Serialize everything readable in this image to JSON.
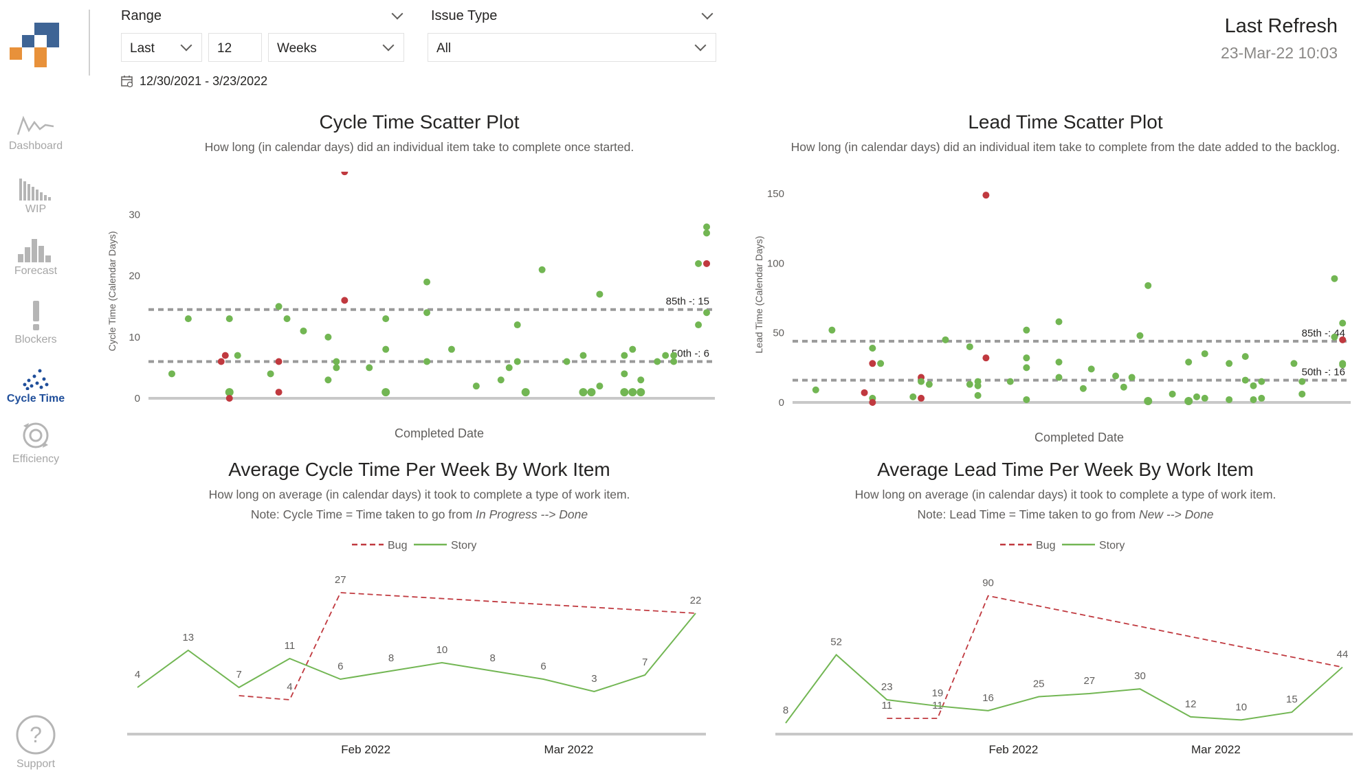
{
  "sidebar": {
    "items": [
      {
        "label": "Dashboard",
        "icon": "line-chart-icon",
        "active": false
      },
      {
        "label": "WIP",
        "icon": "bar-histogram-icon",
        "active": false
      },
      {
        "label": "Forecast",
        "icon": "bar-chart-icon",
        "active": false
      },
      {
        "label": "Blockers",
        "icon": "exclamation-icon",
        "active": false
      },
      {
        "label": "Cycle Time",
        "icon": "scatter-icon",
        "active": true
      },
      {
        "label": "Efficiency",
        "icon": "gear-cycle-icon",
        "active": false
      }
    ],
    "support_label": "Support",
    "support_icon": "question-icon"
  },
  "filters": {
    "range_label": "Range",
    "range_mode": "Last",
    "range_count": "12",
    "range_unit": "Weeks",
    "issue_type_label": "Issue Type",
    "issue_type_value": "All",
    "date_range": "12/30/2021 - 3/23/2022"
  },
  "refresh": {
    "title": "Last Refresh",
    "value": "23-Mar-22 10:03"
  },
  "colors": {
    "story": "#72b653",
    "bug": "#c0393f",
    "percentile_line": "#9a9a9a",
    "active_nav": "#1f4e9a"
  },
  "cycle_scatter": {
    "title": "Cycle Time Scatter Plot",
    "subtitle": "How long (in calendar days) did an individual item take to complete once started.",
    "chart_data": {
      "type": "scatter",
      "xlabel": "Completed Date",
      "ylabel": "Cycle Time (Calendar Days)",
      "ylim": [
        0,
        35
      ],
      "yticks": [
        "0",
        "10",
        "20",
        "30"
      ],
      "percentiles": [
        {
          "label": "85th -: 15",
          "value": 14.5
        },
        {
          "label": "50th -: 6",
          "value": 6
        }
      ],
      "points": [
        {
          "x": 1,
          "y": 4,
          "type": "Story"
        },
        {
          "x": 3,
          "y": 13,
          "type": "Story"
        },
        {
          "x": 7,
          "y": 6,
          "type": "Bug"
        },
        {
          "x": 7.5,
          "y": 7,
          "type": "Bug"
        },
        {
          "x": 8,
          "y": 13,
          "type": "Story"
        },
        {
          "x": 8,
          "y": 1,
          "type": "Story"
        },
        {
          "x": 8,
          "y": 0,
          "type": "Bug"
        },
        {
          "x": 9,
          "y": 7,
          "type": "Story"
        },
        {
          "x": 13,
          "y": 4,
          "type": "Story"
        },
        {
          "x": 14,
          "y": 15,
          "type": "Story"
        },
        {
          "x": 14,
          "y": 6,
          "type": "Bug"
        },
        {
          "x": 14,
          "y": 1,
          "type": "Bug"
        },
        {
          "x": 15,
          "y": 13,
          "type": "Story"
        },
        {
          "x": 17,
          "y": 11,
          "type": "Story"
        },
        {
          "x": 20,
          "y": 10,
          "type": "Story"
        },
        {
          "x": 20,
          "y": 3,
          "type": "Story"
        },
        {
          "x": 21,
          "y": 6,
          "type": "Story"
        },
        {
          "x": 21,
          "y": 5,
          "type": "Story"
        },
        {
          "x": 22,
          "y": 37,
          "type": "Bug"
        },
        {
          "x": 22,
          "y": 16,
          "type": "Bug"
        },
        {
          "x": 25,
          "y": 5,
          "type": "Story"
        },
        {
          "x": 27,
          "y": 13,
          "type": "Story"
        },
        {
          "x": 27,
          "y": 8,
          "type": "Story"
        },
        {
          "x": 27,
          "y": 1,
          "type": "Story"
        },
        {
          "x": 32,
          "y": 19,
          "type": "Story"
        },
        {
          "x": 32,
          "y": 14,
          "type": "Story"
        },
        {
          "x": 32,
          "y": 6,
          "type": "Story"
        },
        {
          "x": 35,
          "y": 8,
          "type": "Story"
        },
        {
          "x": 38,
          "y": 2,
          "type": "Story"
        },
        {
          "x": 41,
          "y": 3,
          "type": "Story"
        },
        {
          "x": 42,
          "y": 5,
          "type": "Story"
        },
        {
          "x": 43,
          "y": 12,
          "type": "Story"
        },
        {
          "x": 43,
          "y": 6,
          "type": "Story"
        },
        {
          "x": 44,
          "y": 1,
          "type": "Story"
        },
        {
          "x": 46,
          "y": 21,
          "type": "Story"
        },
        {
          "x": 49,
          "y": 6,
          "type": "Story"
        },
        {
          "x": 51,
          "y": 7,
          "type": "Story"
        },
        {
          "x": 51,
          "y": 1,
          "type": "Story"
        },
        {
          "x": 52,
          "y": 1,
          "type": "Story"
        },
        {
          "x": 53,
          "y": 17,
          "type": "Story"
        },
        {
          "x": 53,
          "y": 2,
          "type": "Story"
        },
        {
          "x": 56,
          "y": 7,
          "type": "Story"
        },
        {
          "x": 56,
          "y": 4,
          "type": "Story"
        },
        {
          "x": 56,
          "y": 1,
          "type": "Story"
        },
        {
          "x": 57,
          "y": 8,
          "type": "Story"
        },
        {
          "x": 57,
          "y": 1,
          "type": "Story"
        },
        {
          "x": 58,
          "y": 1,
          "type": "Story"
        },
        {
          "x": 58,
          "y": 3,
          "type": "Story"
        },
        {
          "x": 60,
          "y": 6,
          "type": "Story"
        },
        {
          "x": 61,
          "y": 7,
          "type": "Story"
        },
        {
          "x": 62,
          "y": 7,
          "type": "Story"
        },
        {
          "x": 62,
          "y": 6,
          "type": "Story"
        },
        {
          "x": 65,
          "y": 22,
          "type": "Story"
        },
        {
          "x": 65,
          "y": 12,
          "type": "Story"
        },
        {
          "x": 66,
          "y": 28,
          "type": "Story"
        },
        {
          "x": 66,
          "y": 27,
          "type": "Story"
        },
        {
          "x": 66,
          "y": 22,
          "type": "Bug"
        },
        {
          "x": 66,
          "y": 14,
          "type": "Story"
        }
      ]
    }
  },
  "lead_scatter": {
    "title": "Lead Time Scatter Plot",
    "subtitle": "How long (in calendar days) did an individual item take to complete from the date added to the backlog.",
    "chart_data": {
      "type": "scatter",
      "xlabel": "Completed Date",
      "ylabel": "Lead Time (Calendar Days)",
      "ylim": [
        0,
        155
      ],
      "yticks": [
        "0",
        "50",
        "100",
        "150"
      ],
      "percentiles": [
        {
          "label": "85th -: 44",
          "value": 44
        },
        {
          "label": "50th -: 16",
          "value": 16
        }
      ],
      "points": [
        {
          "x": 1,
          "y": 9,
          "type": "Story"
        },
        {
          "x": 3,
          "y": 52,
          "type": "Story"
        },
        {
          "x": 7,
          "y": 7,
          "type": "Bug"
        },
        {
          "x": 8,
          "y": 39,
          "type": "Story"
        },
        {
          "x": 8,
          "y": 28,
          "type": "Bug"
        },
        {
          "x": 8,
          "y": 3,
          "type": "Story"
        },
        {
          "x": 8,
          "y": 0,
          "type": "Bug"
        },
        {
          "x": 9,
          "y": 28,
          "type": "Story"
        },
        {
          "x": 13,
          "y": 4,
          "type": "Story"
        },
        {
          "x": 14,
          "y": 18,
          "type": "Bug"
        },
        {
          "x": 14,
          "y": 15,
          "type": "Story"
        },
        {
          "x": 14,
          "y": 3,
          "type": "Bug"
        },
        {
          "x": 15,
          "y": 13,
          "type": "Story"
        },
        {
          "x": 17,
          "y": 45,
          "type": "Story"
        },
        {
          "x": 20,
          "y": 40,
          "type": "Story"
        },
        {
          "x": 20,
          "y": 13,
          "type": "Story"
        },
        {
          "x": 21,
          "y": 15,
          "type": "Story"
        },
        {
          "x": 21,
          "y": 12,
          "type": "Story"
        },
        {
          "x": 21,
          "y": 5,
          "type": "Story"
        },
        {
          "x": 22,
          "y": 149,
          "type": "Bug"
        },
        {
          "x": 22,
          "y": 32,
          "type": "Bug"
        },
        {
          "x": 25,
          "y": 15,
          "type": "Story"
        },
        {
          "x": 27,
          "y": 52,
          "type": "Story"
        },
        {
          "x": 27,
          "y": 32,
          "type": "Story"
        },
        {
          "x": 27,
          "y": 25,
          "type": "Story"
        },
        {
          "x": 27,
          "y": 2,
          "type": "Story"
        },
        {
          "x": 31,
          "y": 58,
          "type": "Story"
        },
        {
          "x": 31,
          "y": 29,
          "type": "Story"
        },
        {
          "x": 31,
          "y": 18,
          "type": "Story"
        },
        {
          "x": 34,
          "y": 10,
          "type": "Story"
        },
        {
          "x": 35,
          "y": 24,
          "type": "Story"
        },
        {
          "x": 38,
          "y": 19,
          "type": "Story"
        },
        {
          "x": 39,
          "y": 11,
          "type": "Story"
        },
        {
          "x": 40,
          "y": 18,
          "type": "Story"
        },
        {
          "x": 41,
          "y": 48,
          "type": "Story"
        },
        {
          "x": 42,
          "y": 1,
          "type": "Story"
        },
        {
          "x": 42,
          "y": 84,
          "type": "Story"
        },
        {
          "x": 45,
          "y": 6,
          "type": "Story"
        },
        {
          "x": 47,
          "y": 29,
          "type": "Story"
        },
        {
          "x": 47,
          "y": 1,
          "type": "Story"
        },
        {
          "x": 48,
          "y": 4,
          "type": "Story"
        },
        {
          "x": 49,
          "y": 35,
          "type": "Story"
        },
        {
          "x": 49,
          "y": 3,
          "type": "Story"
        },
        {
          "x": 52,
          "y": 28,
          "type": "Story"
        },
        {
          "x": 52,
          "y": 2,
          "type": "Story"
        },
        {
          "x": 54,
          "y": 16,
          "type": "Story"
        },
        {
          "x": 54,
          "y": 33,
          "type": "Story"
        },
        {
          "x": 55,
          "y": 12,
          "type": "Story"
        },
        {
          "x": 55,
          "y": 2,
          "type": "Story"
        },
        {
          "x": 56,
          "y": 15,
          "type": "Story"
        },
        {
          "x": 56,
          "y": 3,
          "type": "Story"
        },
        {
          "x": 60,
          "y": 28,
          "type": "Story"
        },
        {
          "x": 61,
          "y": 15,
          "type": "Story"
        },
        {
          "x": 61,
          "y": 6,
          "type": "Story"
        },
        {
          "x": 65,
          "y": 89,
          "type": "Story"
        },
        {
          "x": 65,
          "y": 47,
          "type": "Story"
        },
        {
          "x": 66,
          "y": 57,
          "type": "Story"
        },
        {
          "x": 66,
          "y": 45,
          "type": "Bug"
        },
        {
          "x": 66,
          "y": 28,
          "type": "Story"
        },
        {
          "x": 66,
          "y": 27,
          "type": "Story"
        }
      ]
    }
  },
  "avg_cycle": {
    "title": "Average Cycle Time Per Week By Work Item",
    "subtitle": "How long on average (in calendar days) it took to complete a type of work item.",
    "note_prefix": "Note: Cycle Time = Time taken to go from ",
    "note_from": "In Progress",
    "note_arrow": " --> ",
    "note_to": "Done",
    "chart_data": {
      "type": "line",
      "xlabel": "",
      "ylabel": "",
      "ylim": [
        0,
        30
      ],
      "x_ticks": [
        {
          "label": "Feb 2022",
          "week": 5
        },
        {
          "label": "Mar 2022",
          "week": 9
        }
      ],
      "series": [
        {
          "name": "Bug",
          "values": [
            null,
            null,
            2,
            1,
            27,
            null,
            null,
            null,
            null,
            null,
            null,
            22
          ]
        },
        {
          "name": "Story",
          "values": [
            4,
            13,
            4,
            11,
            6,
            8,
            10,
            8,
            6,
            3,
            7,
            22
          ]
        }
      ],
      "labels": {
        "Bug": [
          "",
          "",
          "",
          "4",
          "27",
          "",
          "",
          "",
          "",
          "",
          "",
          "22"
        ],
        "Story": [
          "4",
          "13",
          "7",
          "11",
          "6",
          "8",
          "10",
          "8",
          "6",
          "3",
          "7",
          ""
        ]
      }
    }
  },
  "avg_lead": {
    "title": "Average Lead Time Per Week By Work Item",
    "subtitle": "How long on average (in calendar days) it took to complete a type of work item.",
    "note_prefix": "Note: Lead Time = Time taken to go from ",
    "note_from": "New",
    "note_arrow": " --> ",
    "note_to": "Done",
    "chart_data": {
      "type": "line",
      "xlabel": "",
      "ylabel": "",
      "ylim": [
        0,
        100
      ],
      "x_ticks": [
        {
          "label": "Feb 2022",
          "week": 5
        },
        {
          "label": "Mar 2022",
          "week": 9
        }
      ],
      "series": [
        {
          "name": "Bug",
          "values": [
            null,
            null,
            11,
            11,
            90,
            null,
            null,
            null,
            null,
            null,
            null,
            44
          ]
        },
        {
          "name": "Story",
          "values": [
            8,
            52,
            23,
            19,
            16,
            25,
            27,
            30,
            12,
            10,
            15,
            44
          ]
        }
      ],
      "labels": {
        "Bug": [
          "",
          "",
          "11",
          "11",
          "90",
          "",
          "",
          "",
          "",
          "",
          "",
          ""
        ],
        "Story": [
          "8",
          "52",
          "23",
          "19",
          "16",
          "25",
          "27",
          "30",
          "12",
          "10",
          "15",
          "44"
        ]
      }
    }
  }
}
